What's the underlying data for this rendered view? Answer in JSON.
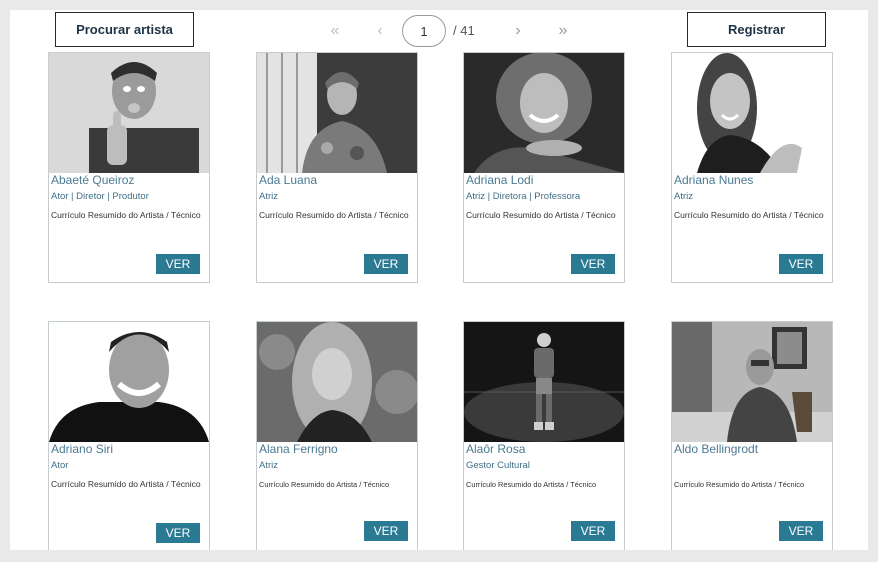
{
  "header": {
    "search_label": "Procurar artista",
    "register_label": "Registrar"
  },
  "pagination": {
    "first_icon": "first-page-icon",
    "prev_icon": "prev-page-icon",
    "current_page": "1",
    "total_pages": "/ 41",
    "next_icon": "next-page-icon",
    "last_icon": "last-page-icon"
  },
  "view_label": "VER",
  "artists": [
    {
      "name": "Abaeté Queiroz",
      "roles": "Ator | Diretor | Produtor",
      "desc": "Currículo Resumido do Artista / Técnico"
    },
    {
      "name": "Ada Luana",
      "roles": "Atriz",
      "desc": "Currículo Resumido do Artista / Técnico"
    },
    {
      "name": "Adriana Lodi",
      "roles": "Atriz | Diretora | Professora",
      "desc": "Currículo Resumido do Artista / Técnico"
    },
    {
      "name": "Adriana Nunes",
      "roles": "Atriz",
      "desc": "Currículo Resumido do Artista / Técnico"
    },
    {
      "name": "Adriano Siri",
      "roles": "Ator",
      "desc": "Currículo Resumido do Artista / Técnico"
    },
    {
      "name": "Alana Ferrigno",
      "roles": "Atriz",
      "desc": "Currículo Resumido do Artista / Técnico"
    },
    {
      "name": "Alaôr Rosa",
      "roles": "Gestor Cultural",
      "desc": "Currículo Resumido do Artista / Técnico"
    },
    {
      "name": "Aldo Bellingrodt",
      "roles": "",
      "desc": "Currículo Resumido do Artista / Técnico"
    }
  ]
}
